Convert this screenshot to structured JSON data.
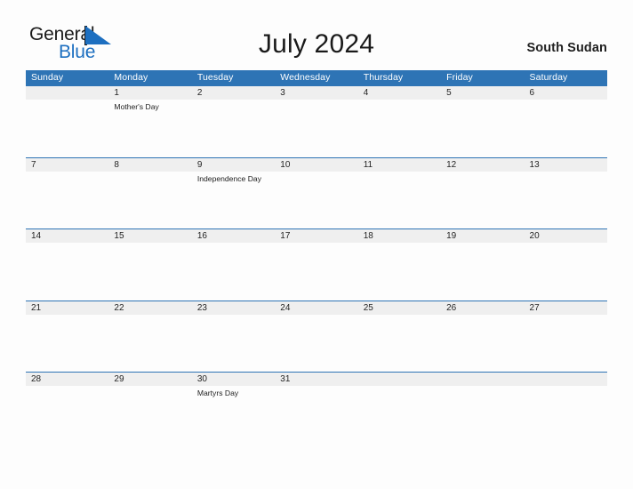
{
  "brand": {
    "name_part1": "General",
    "name_part2": "Blue",
    "color_dark": "#1b1b1b",
    "color_blue": "#1d6fc0"
  },
  "header": {
    "title": "July 2024",
    "region": "South Sudan",
    "accent_color": "#2e74b5",
    "number_band_color": "#efefef",
    "page_background": "#fdfdfd"
  },
  "calendar": {
    "month": "July",
    "year": "2024",
    "day_headers": [
      "Sunday",
      "Monday",
      "Tuesday",
      "Wednesday",
      "Thursday",
      "Friday",
      "Saturday"
    ],
    "weeks": [
      {
        "days": [
          {
            "number": "",
            "event": ""
          },
          {
            "number": "1",
            "event": "Mother's Day"
          },
          {
            "number": "2",
            "event": ""
          },
          {
            "number": "3",
            "event": ""
          },
          {
            "number": "4",
            "event": ""
          },
          {
            "number": "5",
            "event": ""
          },
          {
            "number": "6",
            "event": ""
          }
        ]
      },
      {
        "days": [
          {
            "number": "7",
            "event": ""
          },
          {
            "number": "8",
            "event": ""
          },
          {
            "number": "9",
            "event": "Independence Day"
          },
          {
            "number": "10",
            "event": ""
          },
          {
            "number": "11",
            "event": ""
          },
          {
            "number": "12",
            "event": ""
          },
          {
            "number": "13",
            "event": ""
          }
        ]
      },
      {
        "days": [
          {
            "number": "14",
            "event": ""
          },
          {
            "number": "15",
            "event": ""
          },
          {
            "number": "16",
            "event": ""
          },
          {
            "number": "17",
            "event": ""
          },
          {
            "number": "18",
            "event": ""
          },
          {
            "number": "19",
            "event": ""
          },
          {
            "number": "20",
            "event": ""
          }
        ]
      },
      {
        "days": [
          {
            "number": "21",
            "event": ""
          },
          {
            "number": "22",
            "event": ""
          },
          {
            "number": "23",
            "event": ""
          },
          {
            "number": "24",
            "event": ""
          },
          {
            "number": "25",
            "event": ""
          },
          {
            "number": "26",
            "event": ""
          },
          {
            "number": "27",
            "event": ""
          }
        ]
      },
      {
        "days": [
          {
            "number": "28",
            "event": ""
          },
          {
            "number": "29",
            "event": ""
          },
          {
            "number": "30",
            "event": "Martyrs Day"
          },
          {
            "number": "31",
            "event": ""
          },
          {
            "number": "",
            "event": ""
          },
          {
            "number": "",
            "event": ""
          },
          {
            "number": "",
            "event": ""
          }
        ]
      }
    ]
  }
}
